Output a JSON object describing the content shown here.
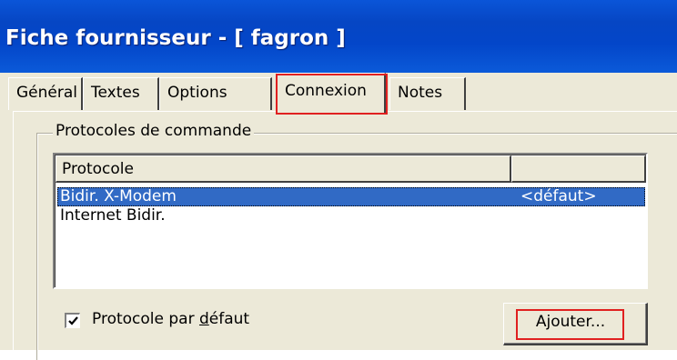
{
  "window": {
    "title": "Fiche fournisseur - [ fagron ]"
  },
  "tabs": [
    {
      "label": "Général",
      "active": false
    },
    {
      "label": "Textes",
      "active": false
    },
    {
      "label": "Options",
      "active": false
    },
    {
      "label": "Connexion",
      "active": true
    },
    {
      "label": "Notes",
      "active": false
    }
  ],
  "group": {
    "legend": "Protocoles de commande"
  },
  "listview": {
    "columns": [
      "Protocole",
      ""
    ],
    "rows": [
      {
        "protocol": "Bidir. X-Modem",
        "note": "<défaut>",
        "selected": true
      },
      {
        "protocol": "Internet Bidir.",
        "note": "",
        "selected": false
      }
    ]
  },
  "checkbox": {
    "label_pre": "Protocole par ",
    "label_mnemonic": "d",
    "label_post": "éfaut",
    "checked": true
  },
  "buttons": {
    "add": "Ajouter..."
  },
  "colors": {
    "titlebar": "#0346c9",
    "selection": "#316ac5",
    "highlight": "#e02020",
    "face": "#ece9d8"
  }
}
